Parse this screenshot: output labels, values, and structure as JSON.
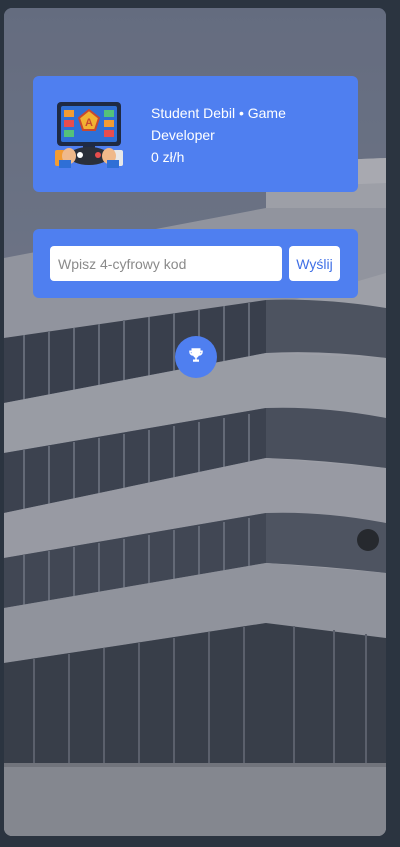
{
  "profile": {
    "title": "Student Debil • Game Developer",
    "rate": "0 zł/h",
    "avatar_icon": "gamer-avatar-icon"
  },
  "code_form": {
    "placeholder": "Wpisz 4-cyfrowy kod",
    "value": "",
    "submit_label": "Wyślij"
  },
  "actions": {
    "leaderboard_icon": "trophy-icon"
  },
  "colors": {
    "accent": "#4f7ff0",
    "button_text": "#3f6fe6",
    "frame": "#2b3440"
  }
}
